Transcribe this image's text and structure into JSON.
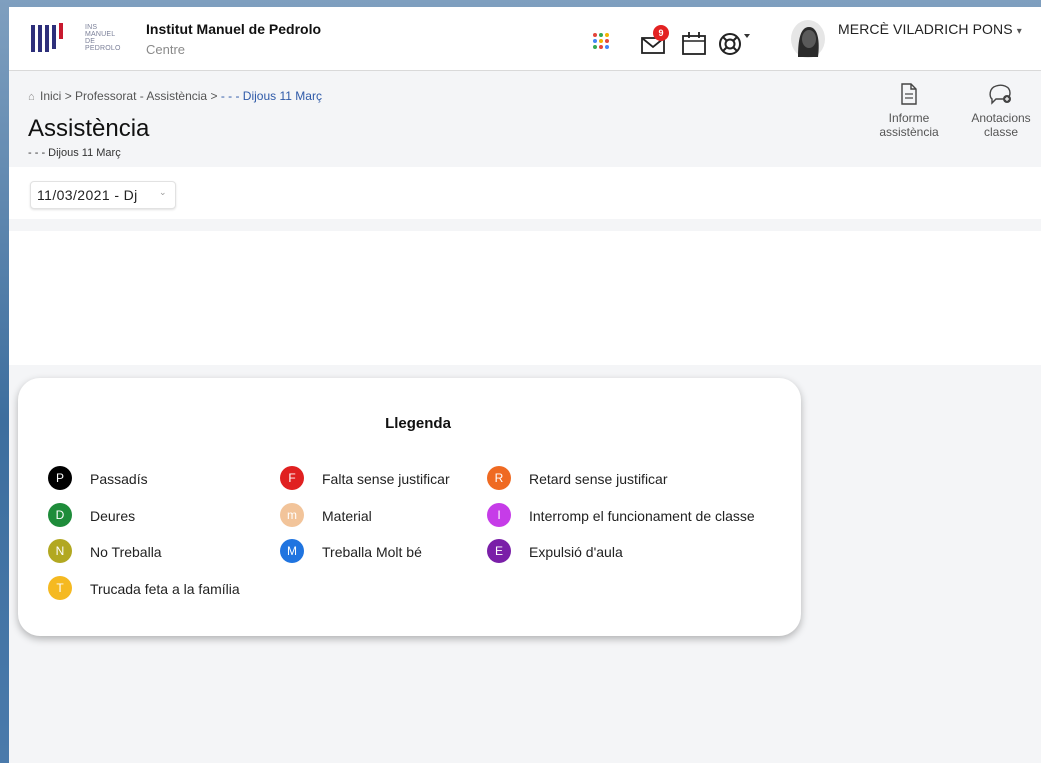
{
  "header": {
    "logo_text": "INS MANUEL DE PEDROLO",
    "school_name": "Institut Manuel de Pedrolo",
    "school_sub": "Centre",
    "mail_badge": "9",
    "user_name": "MERCÈ VILADRICH PONS",
    "user_caret": "▾",
    "icons": [
      "apps-grid-icon",
      "mail-icon",
      "calendar-icon",
      "lifebuoy-help-icon",
      "avatar"
    ]
  },
  "breadcrumb": {
    "home": "Inici",
    "sep1": ">",
    "item1": "Professorat - Assistència",
    "sep2": ">",
    "current": "- - - Dijous 11  Març"
  },
  "page": {
    "title": "Assistència",
    "subtitle": "- - - Dijous 11  Març"
  },
  "actions": {
    "report_line1": "Informe",
    "report_line2": "assistència",
    "notes_line1": "Anotacions",
    "notes_line2": "classe"
  },
  "date_select": {
    "value": "11/03/2021 - Dj",
    "chevron": "⌄"
  },
  "legend": {
    "title": "Llegenda",
    "items": [
      {
        "letter": "P",
        "label": "Passadís",
        "color": "#000000"
      },
      {
        "letter": "D",
        "label": "Deures",
        "color": "#1e8c3a"
      },
      {
        "letter": "N",
        "label": "No Treballa",
        "color": "#b2a821"
      },
      {
        "letter": "T",
        "label": "Trucada feta a la família",
        "color": "#f5b921"
      },
      {
        "letter": "F",
        "label": "Falta sense justificar",
        "color": "#e02020"
      },
      {
        "letter": "m",
        "label": "Material",
        "color": "#f2c49a"
      },
      {
        "letter": "M",
        "label": "Treballa Molt bé",
        "color": "#1f74e0"
      },
      {
        "letter": "R",
        "label": "Retard sense justificar",
        "color": "#ef6a22"
      },
      {
        "letter": "I",
        "label": "Interromp el funcionament de classe",
        "color": "#c63ce8"
      },
      {
        "letter": "E",
        "label": "Expulsió d'aula",
        "color": "#7a1fa8"
      }
    ]
  }
}
